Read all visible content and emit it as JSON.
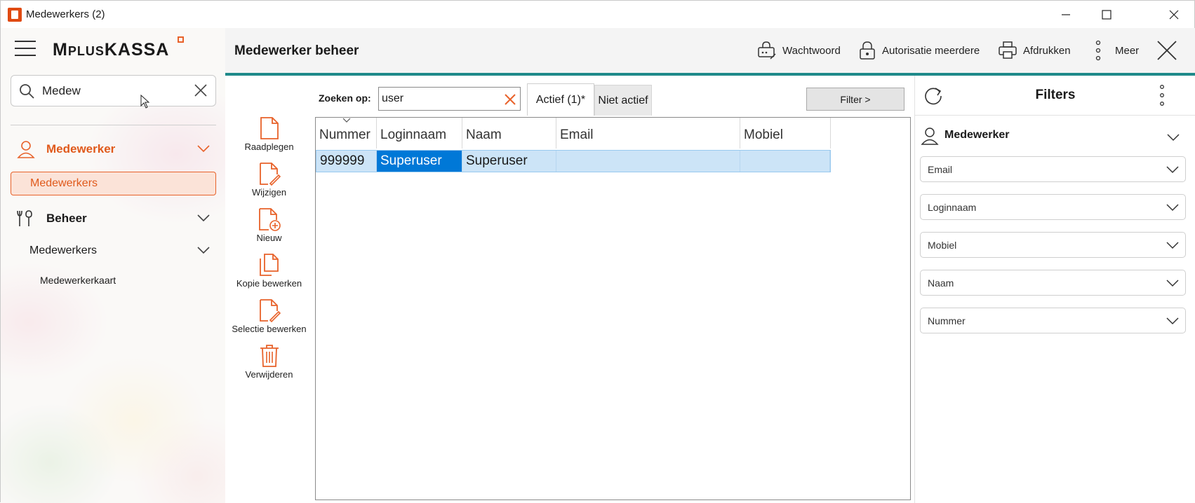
{
  "window": {
    "title": "Medewerkers (2)"
  },
  "sidebar": {
    "logo": {
      "first": "M",
      "small": "PLUS",
      "rest": "KASSA"
    },
    "search": {
      "value": "Medew"
    },
    "nav": [
      {
        "label": "Medewerker",
        "icon": "user-icon",
        "color": "#e05a1c"
      },
      {
        "label": "Medewerkers"
      },
      {
        "label": "Beheer",
        "icon": "tools-icon"
      },
      {
        "label": "Medewerkers"
      },
      {
        "label": "Medewerkerkaart"
      }
    ]
  },
  "header": {
    "title": "Medewerker beheer",
    "actions": {
      "wachtwoord": "Wachtwoord",
      "autorisatie": "Autorisatie meerdere",
      "afdrukken": "Afdrukken",
      "meer": "Meer"
    }
  },
  "actions": {
    "raadplegen": "Raadplegen",
    "wijzigen": "Wijzigen",
    "nieuw": "Nieuw",
    "kopie": "Kopie bewerken",
    "selectie": "Selectie bewerken",
    "verwijderen": "Verwijderen"
  },
  "search": {
    "label": "Zoeken op:",
    "value": "user"
  },
  "tabs": {
    "active": "Actief (1)*",
    "inactive": "Niet actief"
  },
  "filter_button": "Filter >",
  "grid": {
    "columns": [
      "Nummer",
      "Loginnaam",
      "Naam",
      "Email",
      "Mobiel"
    ],
    "rows": [
      {
        "nummer": "999999",
        "loginnaam": "Superuser",
        "naam": "Superuser",
        "email": "",
        "mobiel": ""
      }
    ]
  },
  "filters": {
    "title": "Filters",
    "section": "Medewerker",
    "fields": [
      "Email",
      "Loginnaam",
      "Mobiel",
      "Naam",
      "Nummer"
    ]
  },
  "colors": {
    "accent": "#e8622a",
    "teal": "#1f8a8a",
    "selection": "#0078d7"
  }
}
